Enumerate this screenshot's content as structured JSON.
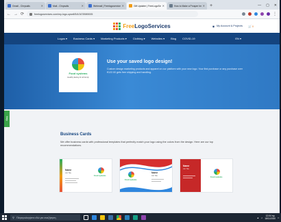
{
  "browser": {
    "tabs": [
      {
        "label": "Gmail - Chrysalis",
        "active": false
      },
      {
        "label": "Mail - Chrysalis",
        "active": false
      },
      {
        "label": "Webmail | Freelogoservices",
        "active": false
      },
      {
        "label": "Gift Updater | FreeLogoServices",
        "active": true
      },
      {
        "label": "How to Make a Prosper Impact",
        "active": false
      }
    ],
    "new_tab": "+",
    "window_controls": [
      "—",
      "▢",
      "✕"
    ],
    "url": "freelogoservices.com/my-logo-upsell/5/4/1678989005",
    "nav": {
      "back": "←",
      "forward": "→",
      "reload": "⟳"
    }
  },
  "site": {
    "logo_free": "Free",
    "logo_rest": "LogoServices",
    "account": "My Account & Projects",
    "cart": "0",
    "nav_items": [
      "Logos",
      "Business Cards",
      "Marketing Products",
      "Clothing",
      "Websites",
      "Blog",
      "COVID-19"
    ],
    "language": "EN"
  },
  "hero": {
    "card_name": "Food systems",
    "card_tag": "Healthy Eating for all family",
    "title": "Use your saved logo design!",
    "description": "Custom design marketing products and apparel on our platform with your new logo. Your first purchase or any purchase over €122.00 gets free shipping and handling."
  },
  "help": "Help",
  "section": {
    "title": "Business Cards",
    "description": "We offer business cards with professional templates that perfectly match your logo using the colors from the design. Here are our top recommendations."
  },
  "cards": [
    {
      "name": "Name",
      "role": "Job Title",
      "brand": "Food systems"
    },
    {
      "name": "Name",
      "role": "Job Title",
      "brand": "Food systems"
    },
    {
      "name": "Name",
      "role": "Job Title",
      "brand": "Food systems"
    }
  ],
  "taskbar": {
    "search_placeholder": "Πληκτρολογήστε εδώ για αναζήτηση",
    "time": "12:04 πμ",
    "date": "18/11/2020"
  },
  "colors": {
    "nav_bg": "#14447f",
    "hero_bg": "#2f79c4",
    "accent": "#f39c12",
    "help": "#3aa34a"
  }
}
